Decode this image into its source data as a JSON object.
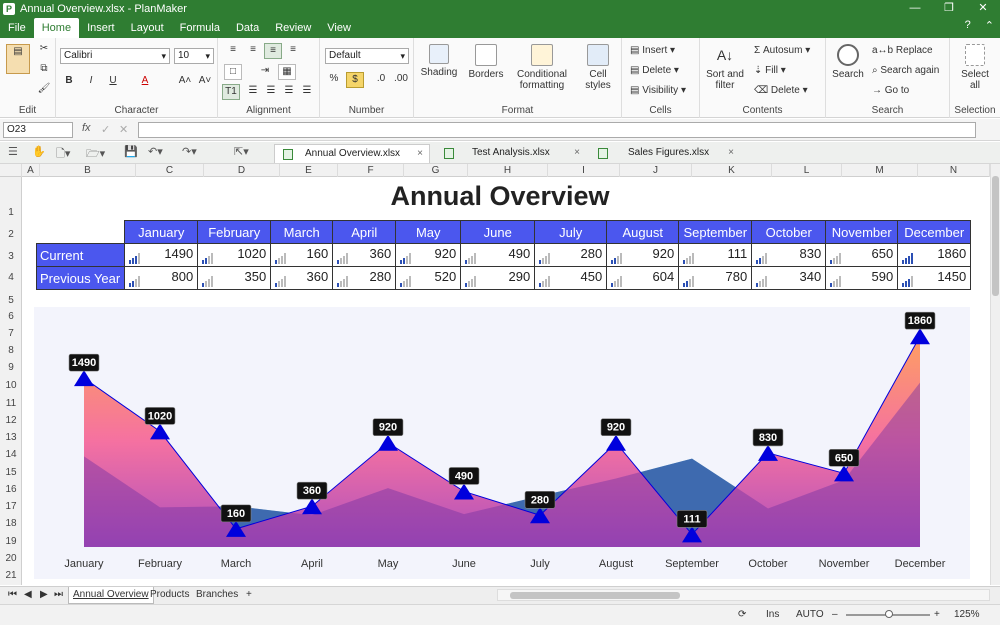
{
  "window": {
    "title": "Annual Overview.xlsx - PlanMaker"
  },
  "menu": {
    "items": [
      "File",
      "Home",
      "Insert",
      "Layout",
      "Formula",
      "Data",
      "Review",
      "View"
    ],
    "active": "Home"
  },
  "ribbon": {
    "font_name": "Calibri",
    "font_size": "10",
    "number_format": "Default",
    "labels": {
      "edit": "Edit",
      "character": "Character",
      "alignment": "Alignment",
      "number": "Number",
      "format": "Format",
      "cells": "Cells",
      "contents": "Contents",
      "search": "Search",
      "selection": "Selection",
      "shading": "Shading",
      "borders": "Borders",
      "conditional": "Conditional",
      "formatting": "formatting",
      "cell": "Cell",
      "styles": "styles",
      "insert": "Insert",
      "delete": "Delete",
      "visibility": "Visibility",
      "sort_and": "Sort and",
      "filter": "filter",
      "autosum": "Autosum",
      "fill": "Fill",
      "delete2": "Delete",
      "search_btn": "Search",
      "replace": "Replace",
      "search_again": "Search again",
      "go_to": "Go to",
      "select": "Select",
      "all": "all"
    }
  },
  "formula_bar": {
    "cell_ref": "O23",
    "fx": "fx"
  },
  "doc_tabs": [
    {
      "label": "Annual Overview.xlsx",
      "active": true
    },
    {
      "label": "Test Analysis.xlsx",
      "active": false
    },
    {
      "label": "Sales Figures.xlsx",
      "active": false
    }
  ],
  "columns": [
    "A",
    "B",
    "C",
    "D",
    "E",
    "F",
    "G",
    "H",
    "I",
    "J",
    "K",
    "L",
    "M",
    "N"
  ],
  "rows": [
    "1",
    "2",
    "3",
    "4",
    "5",
    "6",
    "7",
    "8",
    "9",
    "10",
    "11",
    "12",
    "13",
    "14",
    "15",
    "16",
    "17",
    "18",
    "19",
    "20",
    "21"
  ],
  "sheet": {
    "title": "Annual Overview",
    "months": [
      "January",
      "February",
      "March",
      "April",
      "May",
      "June",
      "July",
      "August",
      "September",
      "October",
      "November",
      "December"
    ],
    "current_label": "Current",
    "previous_label": "Previous Year",
    "current": [
      1490,
      1020,
      160,
      360,
      920,
      490,
      280,
      920,
      111,
      830,
      650,
      1860
    ],
    "previous": [
      800,
      350,
      360,
      280,
      520,
      290,
      450,
      604,
      780,
      340,
      590,
      1450
    ]
  },
  "chart_data": {
    "type": "area",
    "categories": [
      "January",
      "February",
      "March",
      "April",
      "May",
      "June",
      "July",
      "August",
      "September",
      "October",
      "November",
      "December"
    ],
    "series": [
      {
        "name": "Current",
        "values": [
          1490,
          1020,
          160,
          360,
          920,
          490,
          280,
          920,
          111,
          830,
          650,
          1860
        ]
      },
      {
        "name": "Previous Year",
        "values": [
          800,
          350,
          360,
          280,
          520,
          290,
          450,
          604,
          780,
          340,
          590,
          1450
        ]
      }
    ],
    "ylim": [
      0,
      2100
    ],
    "grid": false,
    "colors": {
      "current_top": "#ff9955",
      "current_bottom": "#a843ba",
      "previous": "#0093b5",
      "marker": "#0000dd",
      "label_bg": "#111111",
      "plot_bg": "#f3f4fc"
    }
  },
  "sheet_tabs": {
    "items": [
      "Annual Overview",
      "Products",
      "Branches"
    ],
    "add": "+"
  },
  "status": {
    "ins": "Ins",
    "mode": "AUTO",
    "zoom": "125%"
  }
}
